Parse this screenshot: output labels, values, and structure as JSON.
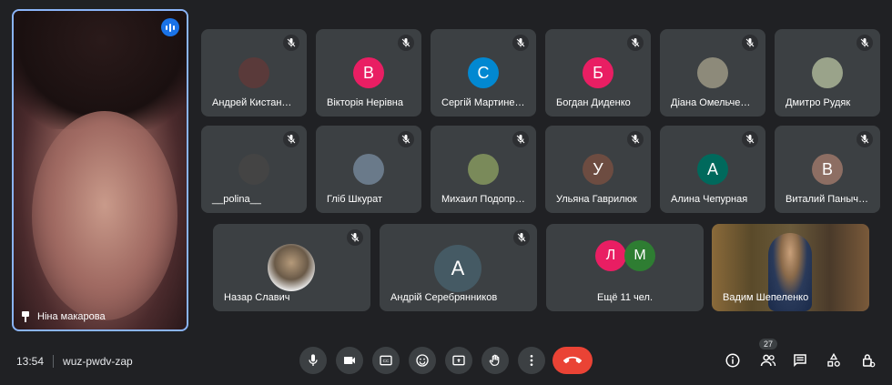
{
  "main_tile": {
    "name": "Ніна макарова"
  },
  "tiles": [
    {
      "name": "Андрей Кистан…",
      "avatar_letter": "",
      "avatar_color": "#5a3a3a"
    },
    {
      "name": "Вікторія Нерівна",
      "avatar_letter": "В",
      "avatar_color": "#e91e63"
    },
    {
      "name": "Сергій Мартине…",
      "avatar_letter": "С",
      "avatar_color": "#0288d1"
    },
    {
      "name": "Богдан Диденко",
      "avatar_letter": "Б",
      "avatar_color": "#e91e63"
    },
    {
      "name": "Діана Омельче…",
      "avatar_letter": "",
      "avatar_color": "#8d8a7a"
    },
    {
      "name": "Дмитро Рудяк",
      "avatar_letter": "",
      "avatar_color": "#9aa38a"
    },
    {
      "name": "__polina__",
      "avatar_letter": "",
      "avatar_color": "#444"
    },
    {
      "name": "Гліб Шкурат",
      "avatar_letter": "",
      "avatar_color": "#6a7a8a"
    },
    {
      "name": "Михаил Подопр…",
      "avatar_letter": "",
      "avatar_color": "#7a8a5a"
    },
    {
      "name": "Ульяна Гаврилюк",
      "avatar_letter": "У",
      "avatar_color": "#6d4c41"
    },
    {
      "name": "Алина Чепурная",
      "avatar_letter": "А",
      "avatar_color": "#00695c"
    },
    {
      "name": "Виталий Паныч…",
      "avatar_letter": "В",
      "avatar_color": "#8d6e63"
    }
  ],
  "row3": {
    "nazar": {
      "name": "Назар Славич"
    },
    "andrii": {
      "name": "Андрій Серебрянников",
      "avatar_letter": "А",
      "avatar_color": "#455a64"
    },
    "more": {
      "text": "Ещё 11 чел.",
      "letter1": "Л",
      "color1": "#e91e63",
      "letter2": "М",
      "color2": "#2e7d32"
    },
    "vadym": {
      "name": "Вадим Шепеленко"
    }
  },
  "bottom": {
    "time": "13:54",
    "meeting_code": "wuz-pwdv-zap",
    "participants_count": "27"
  },
  "icons": [
    "mic-icon",
    "camera-icon",
    "captions-icon",
    "emoji-icon",
    "present-icon",
    "raise-hand-icon",
    "more-icon",
    "end-call-icon",
    "info-icon",
    "people-icon",
    "chat-icon",
    "activities-icon",
    "host-controls-icon"
  ]
}
